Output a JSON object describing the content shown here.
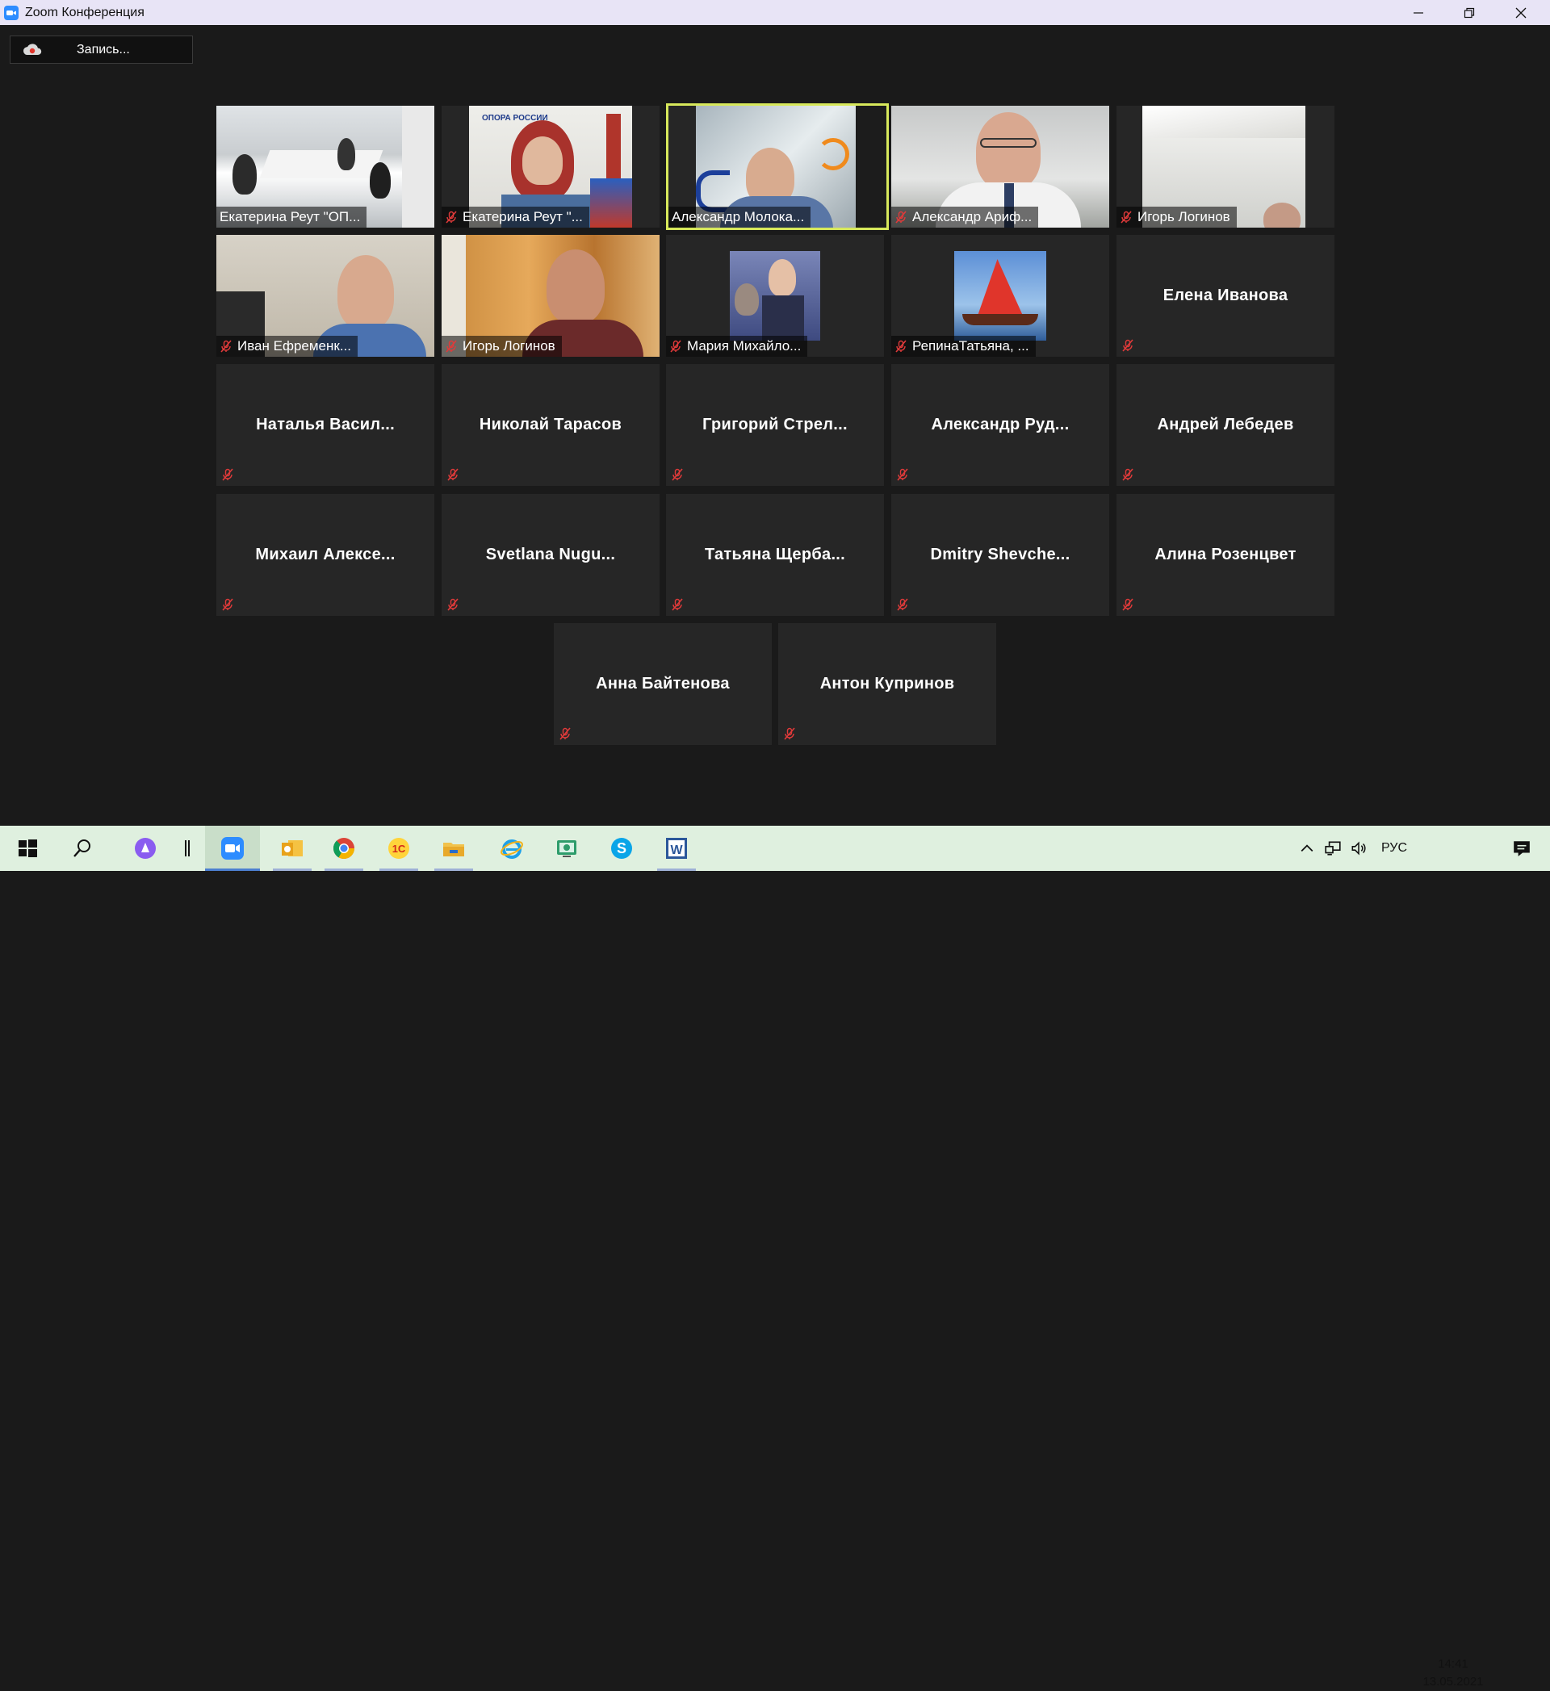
{
  "window": {
    "title": "Zoom Конференция"
  },
  "recording": {
    "label": "Запись..."
  },
  "participants": [
    {
      "name": "Екатерина Реут \"ОП...",
      "video": true,
      "muted": false
    },
    {
      "name": "Екатерина Реут \"...",
      "video": true,
      "muted": true
    },
    {
      "name": "Александр Молока...",
      "video": true,
      "muted": false,
      "active_speaker": true
    },
    {
      "name": "Александр Ариф...",
      "video": true,
      "muted": true
    },
    {
      "name": "Игорь Логинов",
      "video": true,
      "muted": true
    },
    {
      "name": "Иван Ефременк...",
      "video": true,
      "muted": true
    },
    {
      "name": "Игорь Логинов",
      "video": true,
      "muted": true
    },
    {
      "name": "Мария Михайло...",
      "video": true,
      "muted": true
    },
    {
      "name": "РепинаТатьяна, ...",
      "video": true,
      "muted": true
    },
    {
      "name": "Елена Иванова",
      "video": false,
      "muted": true
    },
    {
      "name": "Наталья  Васил...",
      "video": false,
      "muted": true
    },
    {
      "name": "Николай Тарасов",
      "video": false,
      "muted": true
    },
    {
      "name": "Григорий  Стрел...",
      "video": false,
      "muted": true
    },
    {
      "name": "Александр  Руд...",
      "video": false,
      "muted": true
    },
    {
      "name": "Андрей Лебедев",
      "video": false,
      "muted": true
    },
    {
      "name": "Михаил  Алексе...",
      "video": false,
      "muted": true
    },
    {
      "name": "Svetlana  Nugu...",
      "video": false,
      "muted": true
    },
    {
      "name": "Татьяна  Щерба...",
      "video": false,
      "muted": true
    },
    {
      "name": "Dmitry  Shevche...",
      "video": false,
      "muted": true
    },
    {
      "name": "Алина Розенцвет",
      "video": false,
      "muted": true
    },
    {
      "name": "Анна Байтенова",
      "video": false,
      "muted": true
    },
    {
      "name": "Антон Купринов",
      "video": false,
      "muted": true
    }
  ],
  "video_overlay": {
    "logo_text": "ОПОРА РОССИИ"
  },
  "taskbar": {
    "icons": [
      "windows-start-icon",
      "search-icon",
      "alice-icon",
      "taskview-icon",
      "zoom-icon",
      "outlook-icon",
      "chrome-icon",
      "1c-icon",
      "file-explorer-icon",
      "internet-explorer-icon",
      "vm-icon",
      "skype-icon",
      "word-icon"
    ],
    "language": "РУС",
    "time": "14:41",
    "date": "13.05.2021"
  },
  "colors": {
    "active_speaker_border": "#d7e85b",
    "muted_icon": "#e03a3a",
    "tile_bg": "#262626",
    "background": "#1a1a1a"
  }
}
